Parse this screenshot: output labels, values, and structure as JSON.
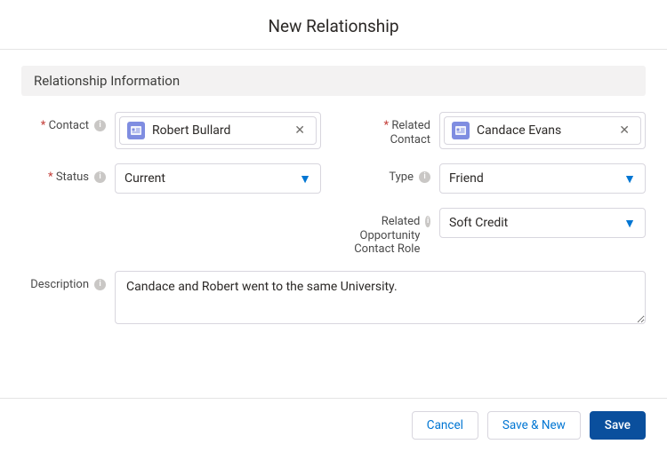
{
  "header": {
    "title": "New Relationship"
  },
  "section": {
    "title": "Relationship Information"
  },
  "labels": {
    "contact": "Contact",
    "related_contact": "Related Contact",
    "status": "Status",
    "type": "Type",
    "related_opp_role": "Related Opportunity Contact Role",
    "description": "Description"
  },
  "values": {
    "contact": "Robert Bullard",
    "related_contact": "Candace Evans",
    "status": "Current",
    "type": "Friend",
    "related_opp_role": "Soft Credit",
    "description": "Candace and Robert went to the same University."
  },
  "footer": {
    "cancel": "Cancel",
    "save_new": "Save & New",
    "save": "Save"
  },
  "info_glyph": "i"
}
